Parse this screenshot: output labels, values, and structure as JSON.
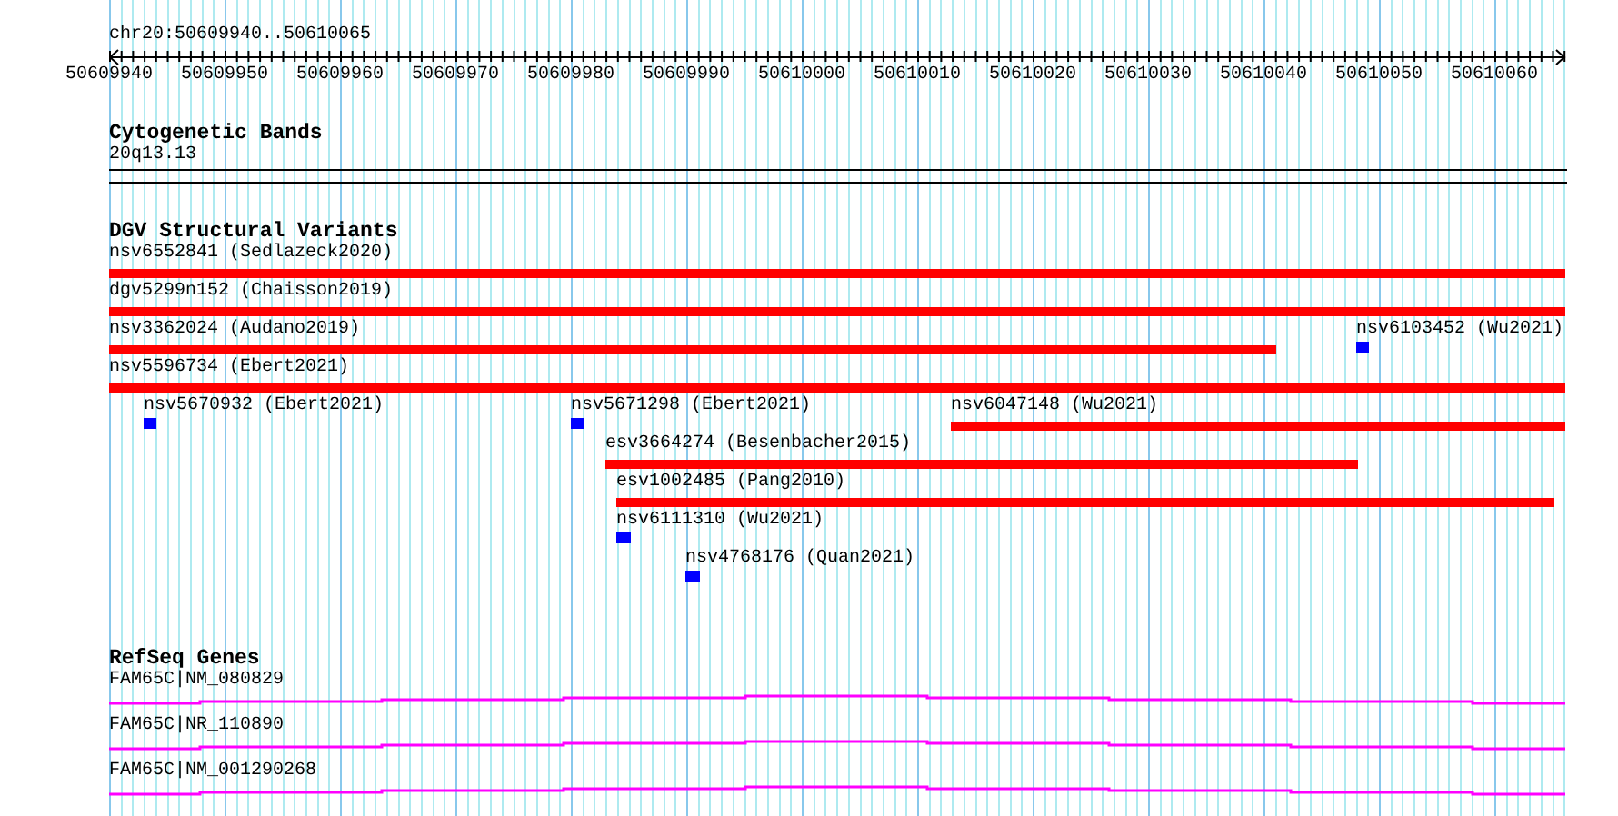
{
  "ruler": {
    "region": "chr20:50609940..50610065",
    "ticks": [
      "50609940",
      "50609950",
      "50609960",
      "50609970",
      "50609980",
      "50609990",
      "50610000",
      "50610010",
      "50610020",
      "50610030",
      "50610040",
      "50610050",
      "50610060"
    ]
  },
  "cytogenetic_bands": {
    "title": "Cytogenetic Bands",
    "band": "20q13.13"
  },
  "dgv_structural_variants": {
    "title": "DGV Structural Variants",
    "rows": [
      {
        "features": [
          {
            "label": "nsv6552841 (Sedlazeck2020)",
            "color": "#ff0000"
          }
        ]
      },
      {
        "features": [
          {
            "label": "dgv5299n152 (Chaisson2019)",
            "color": "#ff0000"
          }
        ]
      },
      {
        "features": [
          {
            "label": "nsv3362024 (Audano2019)",
            "color": "#ff0000"
          },
          {
            "label": "nsv6103452 (Wu2021)",
            "color": "#0000ff"
          }
        ]
      },
      {
        "features": [
          {
            "label": "nsv5596734 (Ebert2021)",
            "color": "#ff0000"
          }
        ]
      },
      {
        "features": [
          {
            "label": "nsv5670932 (Ebert2021)",
            "color": "#0000ff"
          },
          {
            "label": "nsv5671298 (Ebert2021)",
            "color": "#0000ff"
          },
          {
            "label": "nsv6047148 (Wu2021)",
            "color": "#ff0000"
          }
        ]
      },
      {
        "features": [
          {
            "label": "esv3664274 (Besenbacher2015)",
            "color": "#ff0000"
          }
        ]
      },
      {
        "features": [
          {
            "label": "esv1002485 (Pang2010)",
            "color": "#ff0000"
          }
        ]
      },
      {
        "features": [
          {
            "label": "nsv6111310 (Wu2021)",
            "color": "#0000ff"
          }
        ]
      },
      {
        "features": [
          {
            "label": "nsv4768176 (Quan2021)",
            "color": "#0000ff"
          }
        ]
      }
    ]
  },
  "refseq_genes": {
    "title": "RefSeq Genes",
    "genes": [
      {
        "label": "FAM65C|NM_080829"
      },
      {
        "label": "FAM65C|NR_110890"
      },
      {
        "label": "FAM65C|NM_001290268"
      }
    ]
  }
}
